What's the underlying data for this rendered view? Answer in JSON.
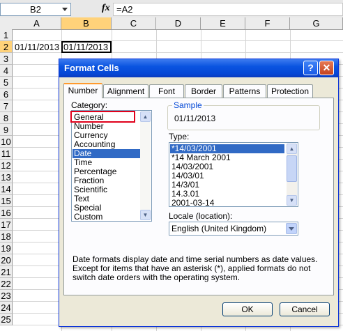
{
  "formula_bar": {
    "name_box": "B2",
    "fx_label": "fx",
    "formula": "=A2"
  },
  "grid": {
    "columns": [
      "A",
      "B",
      "C",
      "D",
      "E",
      "F",
      "G"
    ],
    "rows": [
      "1",
      "2",
      "3",
      "4",
      "5",
      "6",
      "7",
      "8",
      "9",
      "10",
      "11",
      "12",
      "13",
      "14",
      "15",
      "16",
      "17",
      "18",
      "19",
      "20",
      "21",
      "22",
      "23",
      "24",
      "25"
    ],
    "cells": {
      "A2": "01/11/2013",
      "B2": "01/11/2013"
    }
  },
  "dialog": {
    "title": "Format Cells",
    "help_label": "?",
    "close_label": "✕",
    "tabs": [
      "Number",
      "Alignment",
      "Font",
      "Border",
      "Patterns",
      "Protection"
    ],
    "category_label": "Category:",
    "categories": [
      "General",
      "Number",
      "Currency",
      "Accounting",
      "Date",
      "Time",
      "Percentage",
      "Fraction",
      "Scientific",
      "Text",
      "Special",
      "Custom"
    ],
    "selected_category": "Date",
    "sample_label": "Sample",
    "sample_value": "01/11/2013",
    "type_label": "Type:",
    "types": [
      "*14/03/2001",
      "*14 March 2001",
      "14/03/2001",
      "14/03/01",
      "14/3/01",
      "14.3.01",
      "2001-03-14"
    ],
    "selected_type": "*14/03/2001",
    "locale_label": "Locale (location):",
    "locale_value": "English (United Kingdom)",
    "description": "Date formats display date and time serial numbers as date values.  Except for items that have an asterisk (*), applied formats do not switch date orders with the operating system.",
    "ok_label": "OK",
    "cancel_label": "Cancel"
  },
  "colors": {
    "title_bar": "#0a54e0",
    "selection": "#316ac5",
    "highlight_box": "#e0001b",
    "header_selected": "#ffd27a"
  }
}
